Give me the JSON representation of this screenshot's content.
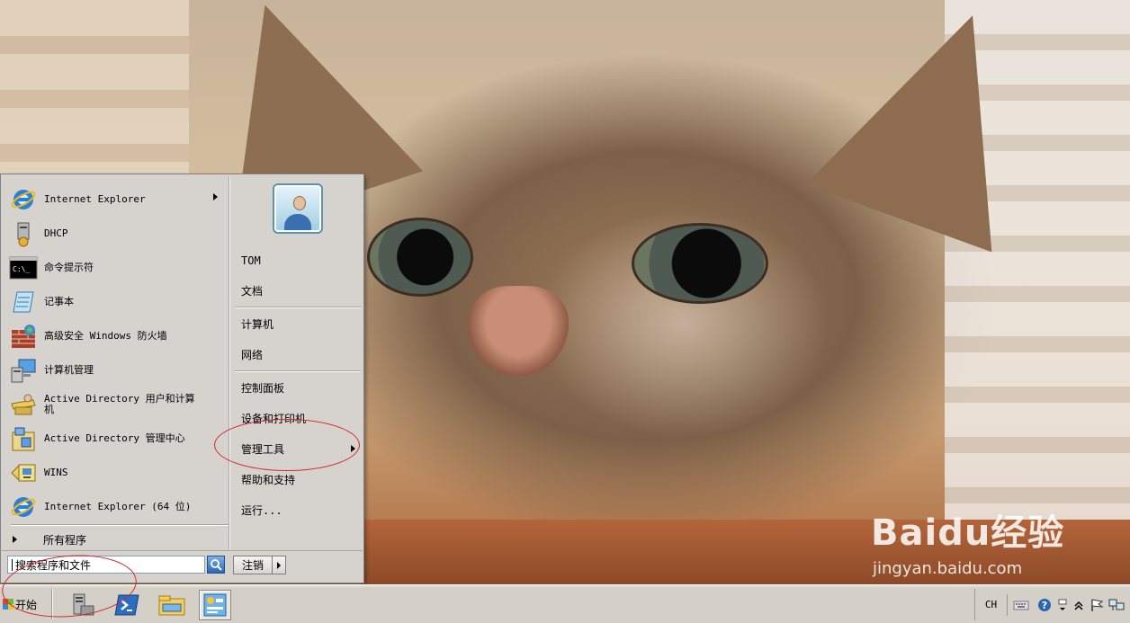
{
  "start_menu": {
    "pinned_items": [
      {
        "label": "Internet Explorer",
        "icon": "internet-explorer-icon",
        "has_submenu": true
      },
      {
        "label": "DHCP",
        "icon": "dhcp-icon"
      },
      {
        "label": "命令提示符",
        "icon": "command-prompt-icon"
      },
      {
        "label": "记事本",
        "icon": "notepad-icon"
      },
      {
        "label": "高级安全 Windows 防火墙",
        "icon": "firewall-icon"
      },
      {
        "label": "计算机管理",
        "icon": "computer-management-icon"
      },
      {
        "label": "Active Directory 用户和计算机",
        "icon": "ad-users-computers-icon"
      },
      {
        "label": "Active Directory 管理中心",
        "icon": "ad-admin-center-icon"
      },
      {
        "label": "WINS",
        "icon": "wins-icon"
      },
      {
        "label": "Internet Explorer (64 位)",
        "icon": "internet-explorer-64-icon"
      }
    ],
    "all_programs": "所有程序",
    "right_items": [
      {
        "label": "TOM"
      },
      {
        "label": "文档"
      },
      {
        "label": "计算机"
      },
      {
        "label": "网络"
      },
      {
        "label": "控制面板"
      },
      {
        "label": "设备和打印机"
      },
      {
        "label": "管理工具",
        "has_submenu": true
      },
      {
        "label": "帮助和支持"
      },
      {
        "label": "运行..."
      }
    ],
    "search_placeholder": "搜索程序和文件",
    "logoff_label": "注销"
  },
  "taskbar": {
    "start_label": "开始",
    "pinned": [
      "server-manager-icon",
      "powershell-icon",
      "windows-explorer-icon",
      "control-panel-icon"
    ],
    "tray": {
      "language": "CH",
      "icons": [
        "keyboard-icon",
        "help-icon",
        "options-icon",
        "show-hidden-icon",
        "action-center-flag-icon",
        "network-icon"
      ]
    }
  },
  "watermark": {
    "brand": "Baidu经验",
    "url": "jingyan.baidu.com"
  },
  "colors": {
    "menu_bg": "#d6d3ce",
    "annotation_red": "#d2262a",
    "taskbar_bg": "#d4d0c8"
  }
}
